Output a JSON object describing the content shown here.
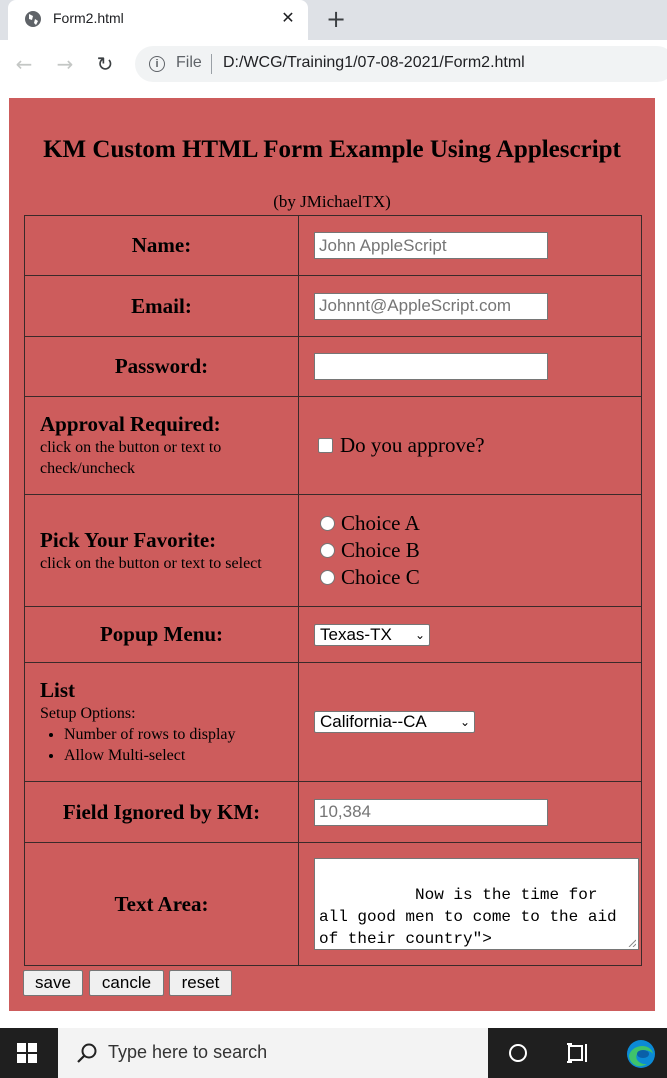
{
  "browser": {
    "tab_title": "Form2.html",
    "close_symbol": "✕",
    "new_tab_symbol": "+",
    "back_symbol": "←",
    "forward_symbol": "→",
    "reload_symbol": "↻",
    "file_label": "File",
    "url": "D:/WCG/Training1/07-08-2021/Form2.html"
  },
  "form": {
    "heading": "KM Custom HTML Form Example Using Applescript",
    "byline": "(by JMichaelTX)",
    "name": {
      "label": "Name:",
      "placeholder": "John AppleScript"
    },
    "email": {
      "label": "Email:",
      "placeholder": "Johnnt@AppleScript.com"
    },
    "password": {
      "label": "Password:",
      "value": ""
    },
    "approval": {
      "label": "Approval Required:",
      "hint": "click on the button or text to check/uncheck",
      "checkbox_label": "Do you approve?",
      "checked": false
    },
    "favorite": {
      "label": "Pick Your Favorite:",
      "hint": "click on the button or text to select",
      "choices": [
        "Choice A",
        "Choice B",
        "Choice C"
      ]
    },
    "popup": {
      "label": "Popup Menu:",
      "selected": "Texas-TX"
    },
    "list": {
      "label": "List",
      "setup_title": "Setup Options:",
      "options": [
        "Number of rows to display",
        "Allow Multi-select"
      ],
      "selected": "California--CA"
    },
    "ignored": {
      "label": "Field Ignored by KM:",
      "placeholder": "10,384"
    },
    "textarea": {
      "label": "Text Area:",
      "value": "Now is the time for all good men to come to the aid of their country\">"
    },
    "buttons": {
      "save": "save",
      "cancel": "cancle",
      "reset": "reset"
    }
  },
  "taskbar": {
    "search_placeholder": "Type here to search"
  },
  "colors": {
    "form_background": "#cd5c5c",
    "taskbar": "#1f1f1f"
  }
}
